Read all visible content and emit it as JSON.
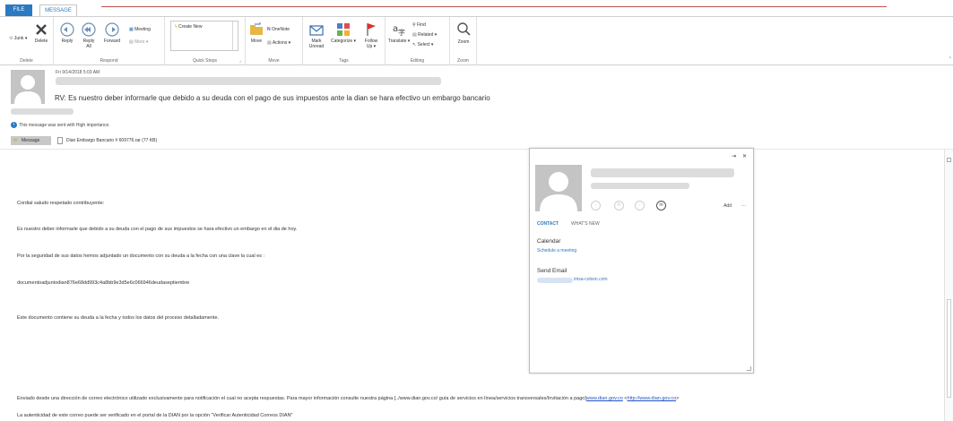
{
  "tabs": {
    "file": "FILE",
    "message": "MESSAGE"
  },
  "ribbon": {
    "delete_group": {
      "junk": "Junk",
      "delete": "Delete",
      "label": "Delete"
    },
    "respond_group": {
      "reply": "Reply",
      "reply_all_1": "Reply",
      "reply_all_2": "All",
      "forward": "Forward",
      "meeting": "Meeting",
      "more": "More",
      "label": "Respond"
    },
    "quick_steps": {
      "create_new": "Create New",
      "label": "Quick Steps"
    },
    "move_group": {
      "move": "Move",
      "onenote": "OneNote",
      "actions": "Actions",
      "label": "Move"
    },
    "tags_group": {
      "mark_unread_1": "Mark",
      "mark_unread_2": "Unread",
      "categorize": "Categorize",
      "follow_up_1": "Follow",
      "follow_up_2": "Up",
      "label": "Tags"
    },
    "editing_group": {
      "translate": "Translate",
      "find": "Find",
      "related": "Related",
      "select": "Select",
      "label": "Editing"
    },
    "zoom_group": {
      "zoom": "Zoom",
      "label": "Zoom"
    }
  },
  "header": {
    "date": "Fri 9/14/2018 5:03 AM",
    "subject": "RV: Es nuestro deber informarle que debido a su deuda con el pago de sus impuestos ante la dian se hara efectivo un embargo bancario",
    "importance": "This message was sent with High importance."
  },
  "attachments": {
    "message_tab": "Message",
    "file": "Dian Embargo Bancario # 609776.rar (77 KB)"
  },
  "body": {
    "p1": "Cordial saludo respetado contribuyente:",
    "p2": "Es nuestro deber informarle que debido a su deuda con el pago de sus impuestos se hara efectivo un embargo  en el dia de hoy.",
    "p3": "Por la seguridad de sus datos hemos adjuntado un documento con su deuda a la fecha con una clave la cual es :",
    "p4": "documentoadjuntodian876e68dd993c4a8bb9e3d5e6c066946deudaseptiembre",
    "p5": "Este documento contiene su deuda a la fecha y todos los datos del proceso detalladamente.",
    "p6_text": "Enviado desde una dirección de correo electrónico utilizado exclusivamente para notificación el cual no acepta respuestas. Para mayor información consulte nuestra página [../www.dian.gov.co/ guía de servicios en línea/servicios transversales/Invitación a pago]",
    "p6_link1": "www.dian.gov.co",
    "p6_mid": " <",
    "p6_link2": "http://www.dian.gov.co",
    "p6_end": ">",
    "p7": "La autenticidad de este correo puede ser verificado en el portal de la DIAN por la opción \"Verificar Autenticidad Correos DIAN\""
  },
  "contact_card": {
    "pin": "⇥",
    "close": "✕",
    "add": "Add",
    "more": "···",
    "tab_contact": "CONTACT",
    "tab_whats_new": "WHAT'S NEW",
    "calendar_heading": "Calendar",
    "schedule_link": "Schedule a meeting",
    "send_email_heading": "Send Email",
    "email_partial": "imsa-colson.com"
  }
}
